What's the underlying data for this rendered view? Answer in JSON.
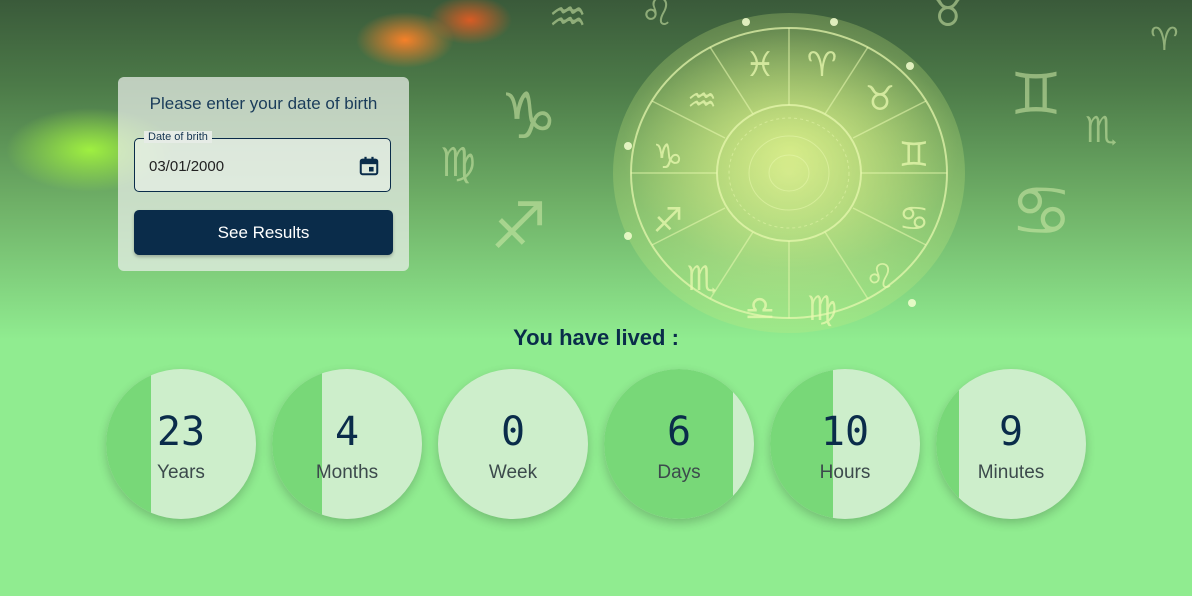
{
  "form": {
    "prompt": "Please enter your date of birth",
    "field_label": "Date of brith",
    "field_value": "03/01/2000",
    "submit_label": "See Results"
  },
  "results": {
    "heading": "You have lived :",
    "items": [
      {
        "value": "23",
        "unit": "Years",
        "fill_fraction": 0.3
      },
      {
        "value": "4",
        "unit": "Months",
        "fill_fraction": 0.33
      },
      {
        "value": "0",
        "unit": "Week",
        "fill_fraction": 0.0
      },
      {
        "value": "6",
        "unit": "Days",
        "fill_fraction": 0.86
      },
      {
        "value": "10",
        "unit": "Hours",
        "fill_fraction": 0.42
      },
      {
        "value": "9",
        "unit": "Minutes",
        "fill_fraction": 0.15
      }
    ]
  },
  "colors": {
    "accent": "#0a2c4a",
    "background": "#90ec90",
    "circle_fill": "#78d878",
    "circle_base": "#cdeecb"
  },
  "icons": {
    "calendar": "calendar-icon",
    "zodiac_wheel": "zodiac-wheel-icon"
  }
}
